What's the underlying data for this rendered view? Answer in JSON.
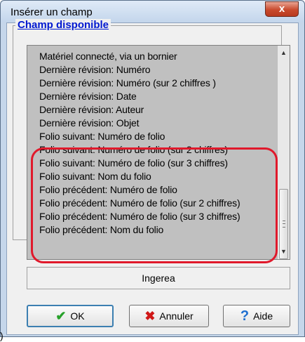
{
  "window": {
    "title": "Insérer un champ",
    "close_label": "x"
  },
  "group": {
    "label": "Champ disponible"
  },
  "list": {
    "items": [
      "Matériel connecté, via un bornier",
      "Dernière révision: Numéro",
      "Dernière révision: Numéro (sur 2 chiffres )",
      "Dernière révision: Date",
      "Dernière révision: Auteur",
      "Dernière révision: Objet",
      "Folio suivant: Numéro de folio",
      "Folio suivant: Numéro de folio (sur 2 chiffres)",
      "Folio suivant: Numéro de folio (sur 3 chiffres)",
      "Folio suivant: Nom du folio",
      "Folio précédent: Numéro de folio",
      "Folio précédent: Numéro de folio (sur 2 chiffres)",
      "Folio précédent: Numéro de folio (sur 3 chiffres)",
      "Folio précédent: Nom du folio"
    ]
  },
  "description": {
    "text": "Ingerea"
  },
  "buttons": {
    "ok": "OK",
    "cancel": "Annuler",
    "help": "Aide"
  },
  "colors": {
    "highlight": "#e0192b",
    "link": "#0018d0"
  },
  "stray_text": ")"
}
